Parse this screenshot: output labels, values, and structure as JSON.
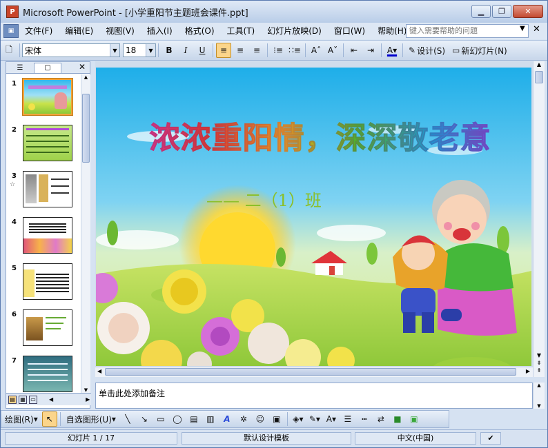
{
  "window": {
    "title": "Microsoft PowerPoint - [小学重阳节主题班会课件.ppt]",
    "app_icon_label": "P"
  },
  "menubar": {
    "items": [
      "文件(F)",
      "编辑(E)",
      "视图(V)",
      "插入(I)",
      "格式(O)",
      "工具(T)",
      "幻灯片放映(D)",
      "窗口(W)",
      "帮助(H)"
    ],
    "help_placeholder": "键入需要帮助的问题"
  },
  "toolbar": {
    "font": "宋体",
    "font_size": "18",
    "bold": "B",
    "italic": "I",
    "underline": "U",
    "design_label": "设计(S)",
    "new_slide_label": "新幻灯片(N)"
  },
  "slides": {
    "numbers": [
      "1",
      "2",
      "3",
      "4",
      "5",
      "6",
      "7"
    ],
    "selected": "1"
  },
  "slide": {
    "title": "浓浓重阳情，深深敬老意",
    "subtitle": "—— 二（1）班"
  },
  "notes": {
    "placeholder": "单击此处添加备注"
  },
  "drawbar": {
    "draw_label": "绘图(R)",
    "autoshape_label": "自选图形(U)"
  },
  "status": {
    "slide_info": "幻灯片 1 / 17",
    "template": "默认设计模板",
    "language": "中文(中国)"
  },
  "colors": {
    "accent": "#fbd58b",
    "title_bar": "#c9d8ec",
    "sky_top": "#25b6ea",
    "grass": "#a8d23a"
  }
}
